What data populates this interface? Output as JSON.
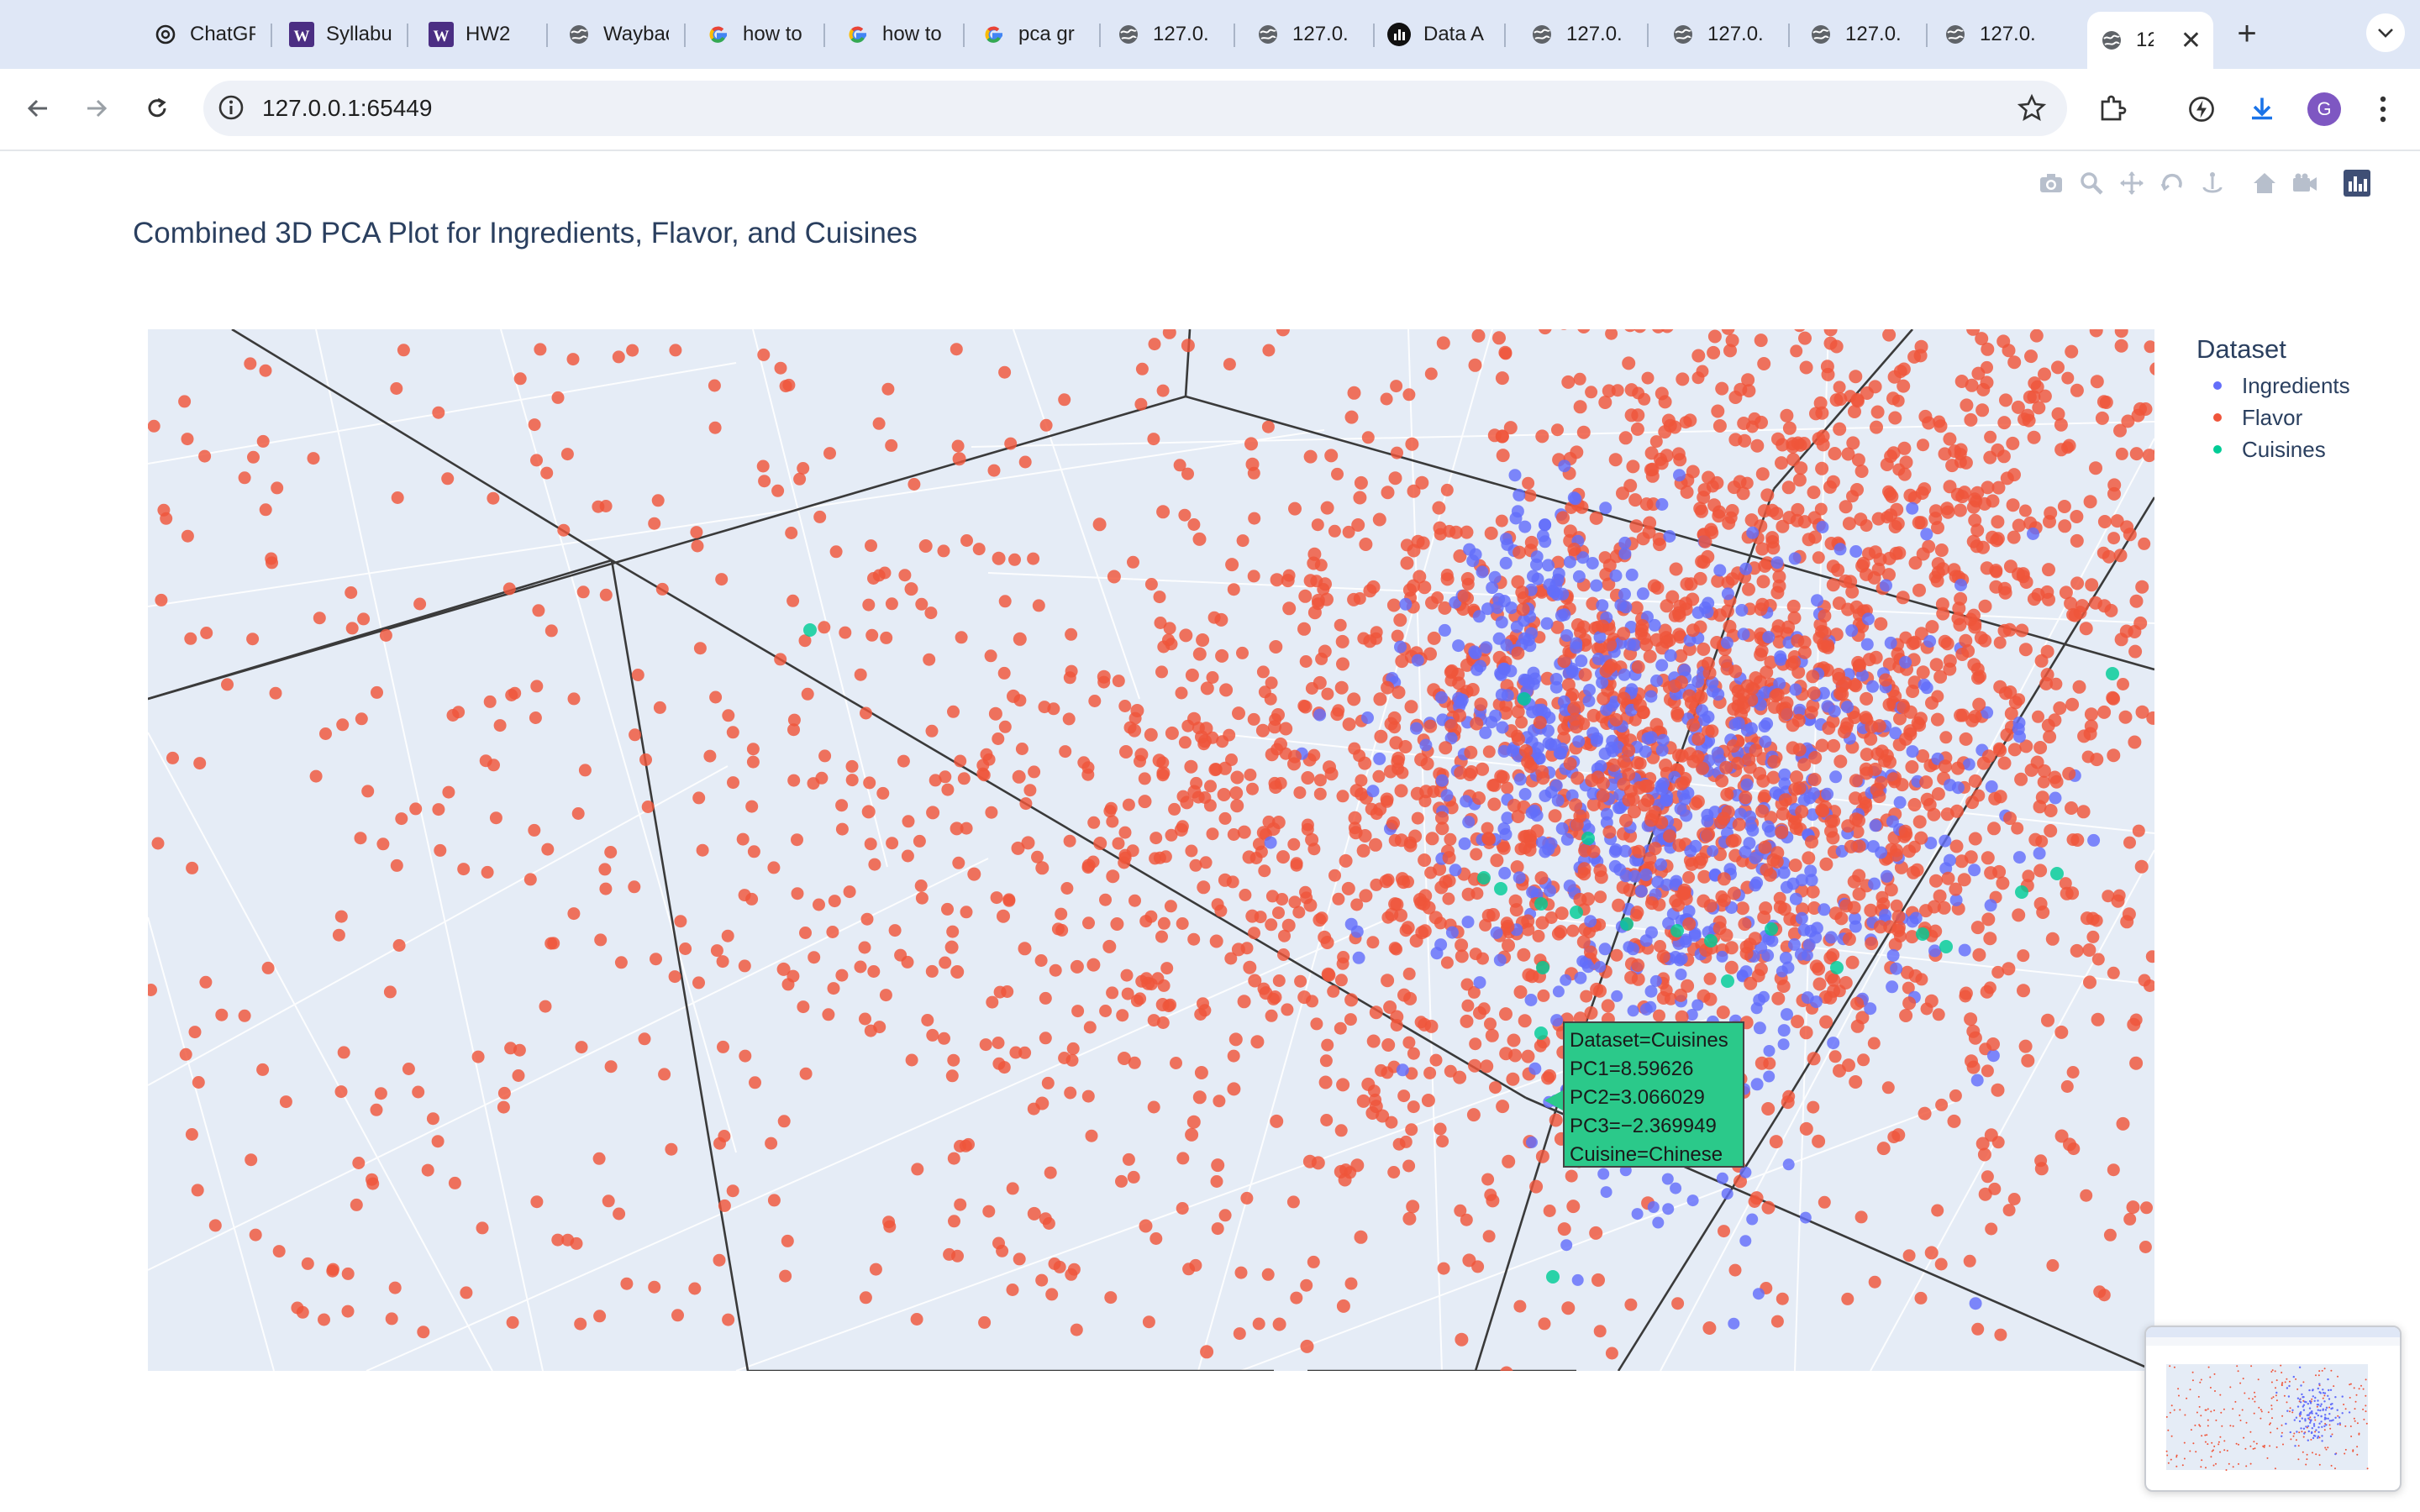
{
  "tabs": [
    {
      "title": "ChatGPT",
      "icon": "chatgpt-icon"
    },
    {
      "title": "Syllabus",
      "icon": "uw-icon"
    },
    {
      "title": "HW2",
      "icon": "uw-icon"
    },
    {
      "title": "Wayback",
      "icon": "globe-icon"
    },
    {
      "title": "how to",
      "icon": "google-icon"
    },
    {
      "title": "how to",
      "icon": "google-icon"
    },
    {
      "title": "pca gr",
      "icon": "google-icon"
    },
    {
      "title": "127.0.",
      "icon": "globe-icon"
    },
    {
      "title": "127.0.",
      "icon": "globe-icon"
    },
    {
      "title": "Data A",
      "icon": "data-icon"
    },
    {
      "title": "127.0.",
      "icon": "globe-icon"
    },
    {
      "title": "127.0.",
      "icon": "globe-icon"
    },
    {
      "title": "127.0.",
      "icon": "globe-icon"
    },
    {
      "title": "127.0.",
      "icon": "globe-icon"
    },
    {
      "title": "12",
      "icon": "globe-icon",
      "active": true
    }
  ],
  "address_bar": {
    "url": "127.0.0.1:65449"
  },
  "profile_initial": "G",
  "plot": {
    "title": "Combined 3D PCA Plot for Ingredients, Flavor, and Cuisines",
    "legend": {
      "title": "Dataset",
      "items": [
        {
          "label": "Ingredients",
          "color": "#636efa"
        },
        {
          "label": "Flavor",
          "color": "#ef553b"
        },
        {
          "label": "Cuisines",
          "color": "#00cc96"
        }
      ]
    },
    "tooltip": {
      "line1": "Dataset=Cuisines",
      "line2": "PC1=8.59626",
      "line3": "PC2=3.066029",
      "line4": "PC3=−2.369949",
      "line5": "Cuisine=Chinese"
    },
    "modebar_icons": [
      "camera-icon",
      "zoom-icon",
      "pan-icon",
      "orbit-icon",
      "turntable-icon",
      "reset-camera-icon",
      "reset-last-icon",
      "plotly-logo-icon"
    ]
  },
  "chart_data": {
    "type": "scatter",
    "title": "Combined 3D PCA Plot for Ingredients, Flavor, and Cuisines",
    "legend_title": "Dataset",
    "legend_placement": "top-right",
    "series": [
      {
        "name": "Ingredients",
        "color": "#636efa"
      },
      {
        "name": "Flavor",
        "color": "#ef553b"
      },
      {
        "name": "Cuisines",
        "color": "#00cc96"
      }
    ],
    "highlighted_point": {
      "Dataset": "Cuisines",
      "PC1": 8.59626,
      "PC2": 3.066029,
      "PC3": -2.369949,
      "Cuisine": "Chinese"
    }
  }
}
